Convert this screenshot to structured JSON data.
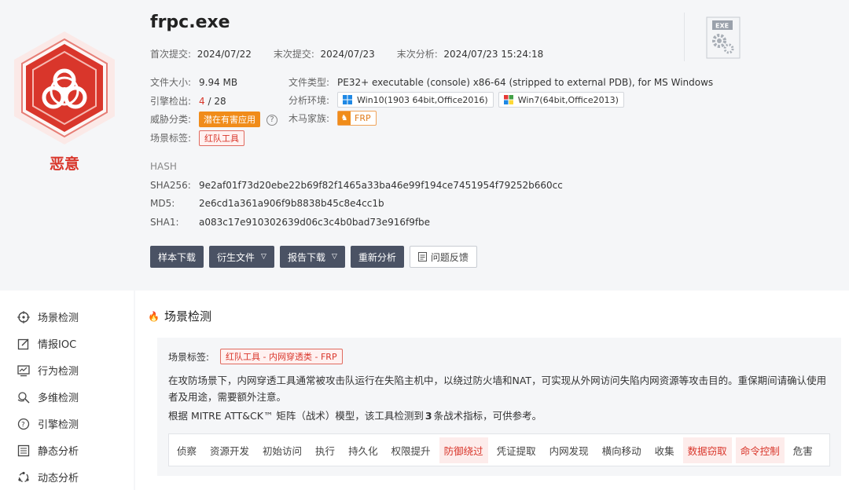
{
  "file": {
    "name": "frpc.exe",
    "first_submit_label": "首次提交:",
    "first_submit": "2024/07/22",
    "last_submit_label": "末次提交:",
    "last_submit": "2024/07/23",
    "last_analysis_label": "末次分析:",
    "last_analysis": "2024/07/23 15:24:18",
    "icon_label": "EXE"
  },
  "verdict": {
    "label": "恶意",
    "color": "#d9362b"
  },
  "info": {
    "size_label": "文件大小:",
    "size": "9.94 MB",
    "type_label": "文件类型:",
    "type": "PE32+ executable (console) x86-64 (stripped to external PDB), for MS Windows",
    "engines_label": "引擎检出:",
    "engines_hit": "4",
    "engines_total": "/ 28",
    "env_label": "分析环境:",
    "env": [
      "Win10(1903 64bit,Office2016)",
      "Win7(64bit,Office2013)"
    ],
    "threat_label": "威胁分类:",
    "threat": "潜在有害应用",
    "help": "?",
    "family_label": "木马家族:",
    "family": "FRP",
    "scene_label": "场景标签:",
    "scene": "红队工具"
  },
  "hash": {
    "heading": "HASH",
    "sha256_label": "SHA256:",
    "sha256": "9e2af01f73d20ebe22b69f82f1465a33ba46e99f194ce7451954f79252b660cc",
    "md5_label": "MD5:",
    "md5": "2e6cd1a361a906f9b8838b45c8e4cc1b",
    "sha1_label": "SHA1:",
    "sha1": "a083c17e910302639d06c3c4b0bad73e916f9fbe"
  },
  "buttons": {
    "sample_download": "样本下载",
    "derived_files": "衍生文件",
    "report_download": "报告下载",
    "reanalyze": "重新分析",
    "feedback": "问题反馈"
  },
  "sidebar": {
    "items": [
      {
        "label": "场景检测"
      },
      {
        "label": "情报IOC"
      },
      {
        "label": "行为检测"
      },
      {
        "label": "多维检测"
      },
      {
        "label": "引擎检测"
      },
      {
        "label": "静态分析"
      },
      {
        "label": "动态分析"
      }
    ]
  },
  "scene": {
    "title": "场景检测",
    "tag_label": "场景标签:",
    "tag": "红队工具 - 内网穿透类 - FRP",
    "desc": "在攻防场景下，内网穿透工具通常被攻击队运行在失陷主机中，以绕过防火墙和NAT，可实现从外网访问失陷内网资源等攻击目的。重保期间请确认使用者及用途，需要额外注意。",
    "mitre_pre": "根据 MITRE ATT&CK™ 矩阵（战术）模型，该工具检测到",
    "mitre_count": "3",
    "mitre_post": "条战术指标，可供参考。",
    "tactics": [
      {
        "label": "侦察",
        "hit": false
      },
      {
        "label": "资源开发",
        "hit": false
      },
      {
        "label": "初始访问",
        "hit": false
      },
      {
        "label": "执行",
        "hit": false
      },
      {
        "label": "持久化",
        "hit": false
      },
      {
        "label": "权限提升",
        "hit": false
      },
      {
        "label": "防御绕过",
        "hit": true
      },
      {
        "label": "凭证提取",
        "hit": false
      },
      {
        "label": "内网发现",
        "hit": false
      },
      {
        "label": "横向移动",
        "hit": false
      },
      {
        "label": "收集",
        "hit": false
      },
      {
        "label": "数据窃取",
        "hit": true
      },
      {
        "label": "命令控制",
        "hit": true
      },
      {
        "label": "危害",
        "hit": false
      }
    ]
  }
}
